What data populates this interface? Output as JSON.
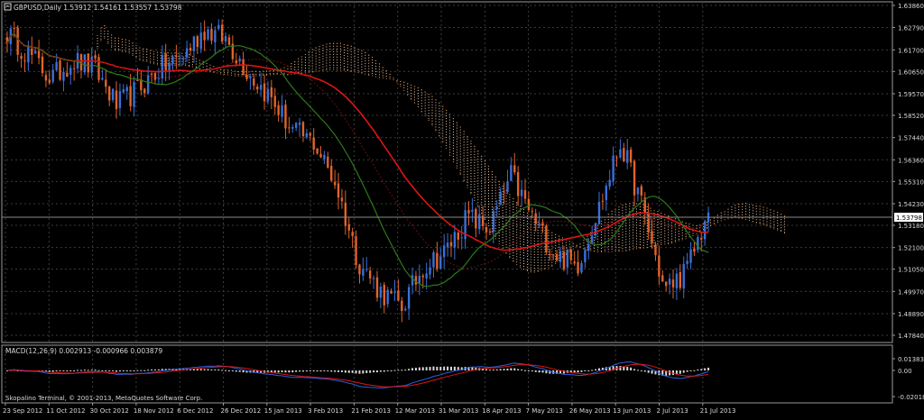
{
  "header": {
    "symbol_line": "GBPUSD,Daily  1.53912 1.54161 1.53557 1.53798"
  },
  "macd": {
    "label": "MACD(12,26,9) 0.002913 -0.000966 0.003879",
    "y_ticks": [
      "0.013834",
      "0.00",
      "-0.020181"
    ]
  },
  "footer": {
    "copyright": "Skopalino Terminal, © 2001-2013, MetaQuotes Software Corp."
  },
  "price_axis": {
    "ticks": [
      "1.63860",
      "1.62790",
      "1.61700",
      "1.60650",
      "1.59570",
      "1.58520",
      "1.57440",
      "1.56360",
      "1.55310",
      "1.54230",
      "1.53180",
      "1.52100",
      "1.51050",
      "1.49970",
      "1.48890",
      "1.47840"
    ],
    "current_price": "1.53798"
  },
  "time_axis": {
    "labels": [
      "23 Sep 2012",
      "11 Oct 2012",
      "30 Oct 2012",
      "18 Nov 2012",
      "6 Dec 2012",
      "26 Dec 2012",
      "15 Jan 2013",
      "3 Feb 2013",
      "21 Feb 2013",
      "12 Mar 2013",
      "31 Mar 2013",
      "18 Apr 2013",
      "7 May 2013",
      "26 May 2013",
      "13 Jun 2013",
      "2 Jul 2013",
      "21 Jul 2013"
    ]
  },
  "colors": {
    "background": "#000000",
    "grid": "#3c3c3c",
    "text": "#d8d8d8",
    "bull_candle": "#3a6fd8",
    "bear_candle": "#e0642a",
    "ma_red": "#e01414",
    "ma_green": "#2c7a1a",
    "cloud": "#f0c8a8",
    "macd_hist": "#d8d8d8",
    "macd_main": "#2a60e0",
    "macd_signal": "#e01414"
  },
  "chart_data": {
    "type": "candlestick",
    "instrument": "GBPUSD",
    "timeframe": "Daily",
    "last_bar": {
      "open": 1.53912,
      "high": 1.54161,
      "low": 1.53557,
      "close": 1.53798
    },
    "ylim": [
      1.4784,
      1.6386
    ],
    "close_path": [
      [
        "23 Sep 2012",
        1.625
      ],
      [
        "1 Oct 2012",
        1.615
      ],
      [
        "11 Oct 2012",
        1.603
      ],
      [
        "20 Oct 2012",
        1.612
      ],
      [
        "30 Oct 2012",
        1.608
      ],
      [
        "8 Nov 2012",
        1.59
      ],
      [
        "18 Nov 2012",
        1.598
      ],
      [
        "27 Nov 2012",
        1.608
      ],
      [
        "6 Dec 2012",
        1.614
      ],
      [
        "16 Dec 2012",
        1.627
      ],
      [
        "26 Dec 2012",
        1.622
      ],
      [
        "5 Jan 2013",
        1.606
      ],
      [
        "15 Jan 2013",
        1.594
      ],
      [
        "24 Jan 2013",
        1.578
      ],
      [
        "3 Feb 2013",
        1.572
      ],
      [
        "12 Feb 2013",
        1.552
      ],
      [
        "21 Feb 2013",
        1.515
      ],
      [
        "3 Mar 2013",
        1.5
      ],
      [
        "12 Mar 2013",
        1.492
      ],
      [
        "22 Mar 2013",
        1.512
      ],
      [
        "31 Mar 2013",
        1.519
      ],
      [
        "9 Apr 2013",
        1.536
      ],
      [
        "18 Apr 2013",
        1.53
      ],
      [
        "28 Apr 2013",
        1.556
      ],
      [
        "7 May 2013",
        1.535
      ],
      [
        "17 May 2013",
        1.518
      ],
      [
        "26 May 2013",
        1.512
      ],
      [
        "5 Jun 2013",
        1.54
      ],
      [
        "13 Jun 2013",
        1.572
      ],
      [
        "23 Jun 2013",
        1.54
      ],
      [
        "2 Jul 2013",
        1.5
      ],
      [
        "12 Jul 2013",
        1.51
      ],
      [
        "21 Jul 2013",
        1.538
      ]
    ]
  }
}
